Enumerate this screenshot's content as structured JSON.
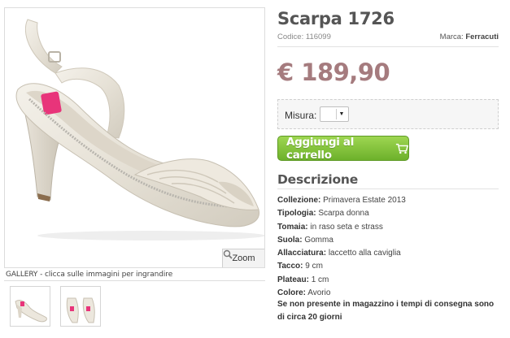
{
  "gallery": {
    "zoom_label": "Zoom",
    "caption": "GALLERY - clicca sulle immagini per ingrandire",
    "thumbnails": [
      "thumbnail-1",
      "thumbnail-2"
    ]
  },
  "product": {
    "title": "Scarpa 1726",
    "code_label": "Codice:",
    "code_value": "116099",
    "brand_label": "Marca:",
    "brand_value": "Ferracuti",
    "price": "€ 189,90",
    "price_color": "#a57b7e"
  },
  "options": {
    "size_label": "Misura:",
    "size_value": ""
  },
  "cart": {
    "button_label": "Aggiungi al carrello",
    "button_color": "#7cc236"
  },
  "description": {
    "heading": "Descrizione",
    "attributes": [
      {
        "label": "Collezione:",
        "value": "Primavera Estate 2013"
      },
      {
        "label": "Tipologia:",
        "value": "Scarpa donna"
      },
      {
        "label": "Tomaia:",
        "value": "in raso seta e strass"
      },
      {
        "label": "Suola:",
        "value": "Gomma"
      },
      {
        "label": "Allacciatura:",
        "value": "laccetto alla caviglia"
      },
      {
        "label": "Tacco:",
        "value": "9 cm"
      },
      {
        "label": "Plateau:",
        "value": "1 cm"
      },
      {
        "label": "Colore:",
        "value": "Avorio"
      }
    ],
    "delivery_note": "Se non presente in magazzino i tempi di consegna sono di circa 20 giorni"
  }
}
